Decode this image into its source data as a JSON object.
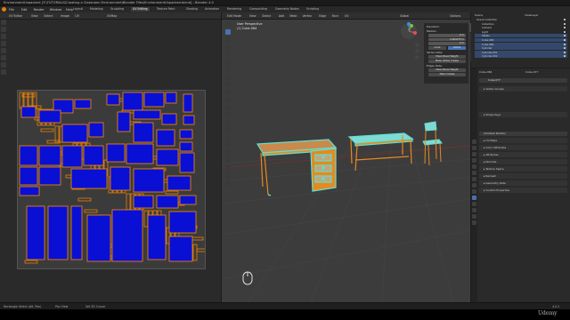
{
  "window_title": "EnvironmentUnpacked: [F:\\TUTORIALS\\Creating a Classroom Environment\\Blender Files\\EnvironmentUnpacked.blend] - Blender 4.0",
  "menu": [
    "File",
    "Edit",
    "Render",
    "Window",
    "Help"
  ],
  "workspace_tabs": [
    "Layout",
    "Modeling",
    "Sculpting",
    "UV Editing",
    "Texture Paint",
    "Shading",
    "Animation",
    "Rendering",
    "Compositing",
    "Geometry Nodes",
    "Scripting"
  ],
  "active_workspace": "UV Editing",
  "uv_editor": {
    "header_items": [
      "UV Editor",
      "View",
      "Select",
      "Image",
      "UV"
    ],
    "image_name": "UVMap"
  },
  "viewport": {
    "header_items": [
      "Edit Mode",
      "View",
      "Select",
      "Add",
      "Mesh",
      "Vertex",
      "Edge",
      "Face",
      "UV"
    ],
    "header_right": [
      "Global",
      "Options"
    ],
    "info_line1": "User Perspective",
    "info_line2": "(1) Cube.084",
    "npanel": {
      "section": "Transform",
      "median_label": "Median:",
      "fields": [
        {
          "label": "X",
          "value": "0 m"
        },
        {
          "label": "Y",
          "value": "0.064275 m"
        },
        {
          "label": "Z",
          "value": "0 m"
        }
      ],
      "toggle": [
        "Local",
        "Global"
      ],
      "edge_data": "Vertex Data:",
      "buttons1": [
        "Mean Bevel Weight",
        "Mean Vertex Crease"
      ],
      "edge_section": "Edges Data:",
      "buttons2": [
        "Mean Bevel Weight",
        "Mean Crease"
      ],
      "values": [
        "0.00",
        "0.00",
        "0.00",
        "0.00"
      ],
      "tabs": [
        "Item",
        "Tool",
        "View",
        "Edit"
      ]
    }
  },
  "outliner": {
    "header": "Scene",
    "view_layer": "ViewLayer",
    "rows": [
      {
        "label": "Scene Collection",
        "selected": false
      },
      {
        "label": "Collection",
        "selected": false
      },
      {
        "label": "Camera",
        "selected": false
      },
      {
        "label": "Light",
        "selected": false
      },
      {
        "label": "Tables",
        "selected": true
      },
      {
        "label": "Cube.083",
        "selected": true
      },
      {
        "label": "Cube.084",
        "selected": true
      },
      {
        "label": "Cylinder",
        "selected": true
      },
      {
        "label": "Cylinder.001",
        "selected": true
      },
      {
        "label": "Cylinder.002",
        "selected": true
      }
    ]
  },
  "properties": {
    "object_name": "Cube.084",
    "data_name": "Cube.077",
    "mesh_name": "Cube.077",
    "panels": [
      "Vertex Groups",
      "Shape Keys",
      "UV Maps",
      "Color Attributes",
      "Attributes",
      "Normals",
      "Texture Space",
      "Remesh",
      "Geometry Data",
      "Custom Properties"
    ],
    "add_rest": "Add Rest Position"
  },
  "status_bar": {
    "left": "Rectangle Select (Alt, Pan)",
    "middle": "Pan View",
    "right": "Set 3D Cursor",
    "version": "4.0.2"
  },
  "watermark": "Udemy",
  "colors": {
    "uv_island_fill": "#0a0fd4",
    "uv_edge": "#ff8a00",
    "selected_wire": "#5fe0d6",
    "furniture_orange": "#e58a1f",
    "accent_blue": "#33486b"
  },
  "icons": [
    "mouse-icon",
    "gizmo-axis-icon",
    "eye-icon",
    "camera-icon"
  ]
}
